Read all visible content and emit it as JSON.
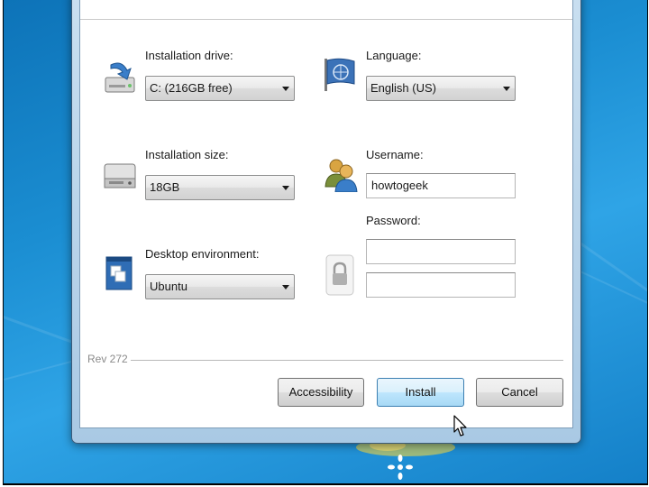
{
  "installer": {
    "installation_drive": {
      "label": "Installation drive:",
      "value": "C: (216GB free)"
    },
    "language": {
      "label": "Language:",
      "value": "English (US)"
    },
    "installation_size": {
      "label": "Installation size:",
      "value": "18GB"
    },
    "username": {
      "label": "Username:",
      "value": "howtogeek"
    },
    "password": {
      "label": "Password:",
      "value": "",
      "confirm_value": ""
    },
    "desktop_environment": {
      "label": "Desktop environment:",
      "value": "Ubuntu"
    },
    "revision": "Rev 272",
    "buttons": {
      "accessibility": "Accessibility",
      "install": "Install",
      "cancel": "Cancel"
    }
  },
  "icons": {
    "drive": "drive-download-icon",
    "language": "globe-flag-icon",
    "size": "hard-disk-icon",
    "username": "users-icon",
    "desktop": "desktop-window-icon",
    "password": "padlock-icon"
  },
  "colors": {
    "install_button": "#bee6fd",
    "desktop_background": "#1b8ed2",
    "ubuntu_logo": "#dd4814"
  }
}
